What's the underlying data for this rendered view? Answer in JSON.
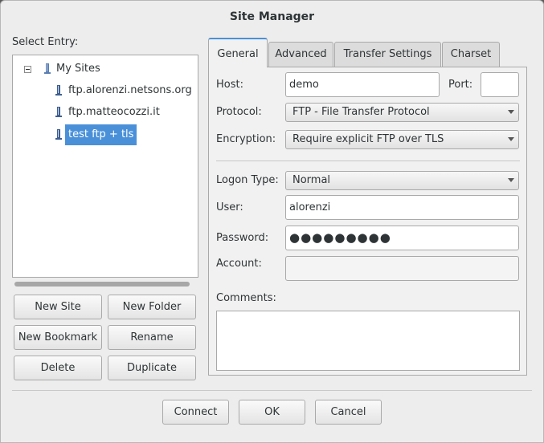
{
  "window": {
    "title": "Site Manager"
  },
  "left_panel": {
    "select_entry_label": "Select Entry:",
    "tree": {
      "root": "My Sites",
      "items": [
        {
          "label": "ftp.alorenzi.netsons.org",
          "selected": false
        },
        {
          "label": "ftp.matteocozzi.it",
          "selected": false
        },
        {
          "label": "test ftp + tls",
          "selected": true
        }
      ]
    },
    "buttons": {
      "new_site": "New Site",
      "new_folder": "New Folder",
      "new_bookmark": "New Bookmark",
      "rename": "Rename",
      "delete": "Delete",
      "duplicate": "Duplicate"
    }
  },
  "tabs": [
    {
      "label": "General",
      "active": true
    },
    {
      "label": "Advanced",
      "active": false
    },
    {
      "label": "Transfer Settings",
      "active": false
    },
    {
      "label": "Charset",
      "active": false
    }
  ],
  "general": {
    "host_label": "Host:",
    "host_value": "demo",
    "port_label": "Port:",
    "port_value": "",
    "protocol_label": "Protocol:",
    "protocol_value": "FTP - File Transfer Protocol",
    "encryption_label": "Encryption:",
    "encryption_value": "Require explicit FTP over TLS",
    "logon_type_label": "Logon Type:",
    "logon_type_value": "Normal",
    "user_label": "User:",
    "user_value": "alorenzi",
    "password_label": "Password:",
    "password_value": "●●●●●●●●●",
    "account_label": "Account:",
    "account_value": "",
    "comments_label": "Comments:",
    "comments_value": ""
  },
  "footer": {
    "connect": "Connect",
    "ok": "OK",
    "cancel": "Cancel"
  },
  "colors": {
    "selection": "#4a90d9",
    "window_bg": "#ededed"
  }
}
